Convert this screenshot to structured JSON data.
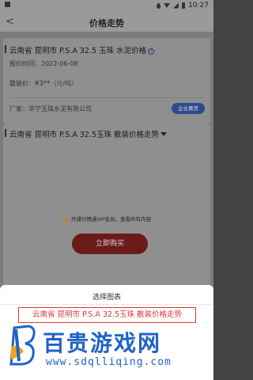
{
  "status_bar": {
    "icons": [
      "image-icon",
      "location-icon",
      "wifi-icon",
      "signal-icon",
      "battery-icon"
    ],
    "time": "10:27"
  },
  "nav": {
    "back": "<",
    "title": "价格走势"
  },
  "product": {
    "title": "云南省 昆明市 P.S.A 32.5 玉珠 水泥价格",
    "help": "?",
    "date_label": "报价时间：",
    "date": "2022-06-08",
    "price_label": "散装价：",
    "price": "¥3**",
    "price_unit": "（元/吨）",
    "maker_label": "厂家：",
    "maker": "华宁玉珠水泥有限公司",
    "yellow_pages": "企业黄页"
  },
  "trend": {
    "title": "云南省 昆明市 P.S.A 32.5玉珠 散装价格走势",
    "vip_text": "开通行情通VIP会员，查看所有内容",
    "buy_label": "立即购买"
  },
  "sheet": {
    "title": "选择图表",
    "option": "云南省 昆明市 P.S.A 32.5玉珠 散装价格走势"
  },
  "watermark": {
    "main": "百贵游戏网",
    "url": "www.sdqlliqing.com"
  },
  "colors": {
    "accent_red": "#e23636",
    "brand_blue": "#1f63c7"
  }
}
